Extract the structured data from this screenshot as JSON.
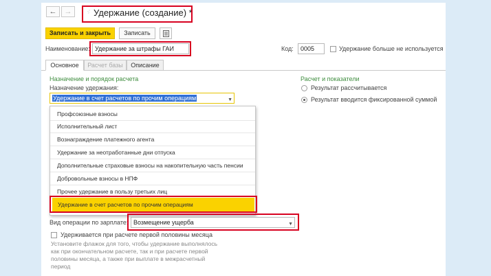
{
  "window": {
    "title": "Удержание (создание) *",
    "nav_back": "←",
    "nav_forward": "→"
  },
  "toolbar": {
    "save_close_label": "Записать и закрыть",
    "save_label": "Записать",
    "list_icon": "list-icon"
  },
  "header": {
    "name_label": "Наименование:",
    "name_value": "Удержание за штрафы ГАИ",
    "code_label": "Код:",
    "code_value": "0005",
    "unused_label": "Удержание больше не используется"
  },
  "tabs": [
    {
      "label": "Основное"
    },
    {
      "label": "Расчет базы"
    },
    {
      "label": "Описание"
    }
  ],
  "left_section": {
    "title": "Назначение и порядок расчета",
    "purpose_label": "Назначение удержания:",
    "purpose_value": "Удержание в счет расчетов по прочим операциям"
  },
  "dropdown": {
    "items": [
      "Профсоюзные взносы",
      "Исполнительный лист",
      "Вознаграждение платежного агента",
      "Удержание за неотработанные дни отпуска",
      "Дополнительные страховые взносы на накопительную часть пенсии",
      "Добровольные взносы в НПФ",
      "Прочее удержание в пользу третьих лиц",
      "Удержание в счет расчетов по прочим операциям"
    ]
  },
  "operation": {
    "label": "Вид операции по зарплате:",
    "value": "Возмещение ущерба"
  },
  "first_half": {
    "label": "Удерживается при расчете первой половины месяца",
    "hint_1": "Установите флажок для того, чтобы удержание выполнялось",
    "hint_2": "как при окончательном расчете, так и при расчете первой",
    "hint_3": "половины месяца, а также при выплате в межрасчетный",
    "hint_4": "период"
  },
  "right_section": {
    "title": "Расчет и показатели",
    "option_calculated": "Результат рассчитывается",
    "option_fixed": "Результат вводится фиксированной суммой"
  },
  "colors": {
    "accent_yellow": "#fad200",
    "highlight_red": "#d7001f",
    "section_green": "#3f8d3f",
    "selection_blue": "#2f6fd6"
  }
}
